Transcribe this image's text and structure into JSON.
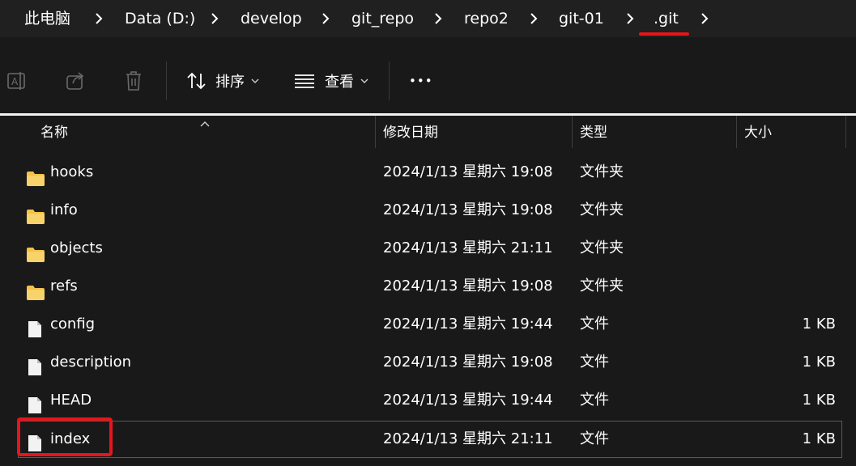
{
  "breadcrumb": {
    "items": [
      "此电脑",
      "Data (D:)",
      "develop",
      "git_repo",
      "repo2",
      "git-01",
      ".git"
    ]
  },
  "toolbar": {
    "sort_label": "排序",
    "view_label": "查看",
    "more_label": "•••"
  },
  "columns": {
    "name": "名称",
    "date": "修改日期",
    "type": "类型",
    "size": "大小"
  },
  "files": [
    {
      "name": "hooks",
      "date": "2024/1/13 星期六 19:08",
      "type": "文件夹",
      "size": "",
      "kind": "folder"
    },
    {
      "name": "info",
      "date": "2024/1/13 星期六 19:08",
      "type": "文件夹",
      "size": "",
      "kind": "folder"
    },
    {
      "name": "objects",
      "date": "2024/1/13 星期六 21:11",
      "type": "文件夹",
      "size": "",
      "kind": "folder"
    },
    {
      "name": "refs",
      "date": "2024/1/13 星期六 19:08",
      "type": "文件夹",
      "size": "",
      "kind": "folder"
    },
    {
      "name": "config",
      "date": "2024/1/13 星期六 19:44",
      "type": "文件",
      "size": "1 KB",
      "kind": "file"
    },
    {
      "name": "description",
      "date": "2024/1/13 星期六 19:08",
      "type": "文件",
      "size": "1 KB",
      "kind": "file"
    },
    {
      "name": "HEAD",
      "date": "2024/1/13 星期六 19:44",
      "type": "文件",
      "size": "1 KB",
      "kind": "file"
    },
    {
      "name": "index",
      "date": "2024/1/13 星期六 21:11",
      "type": "文件",
      "size": "1 KB",
      "kind": "file"
    }
  ],
  "colors": {
    "background": "#191919",
    "highlight": "#e8141b",
    "folder": "#f4c247"
  }
}
